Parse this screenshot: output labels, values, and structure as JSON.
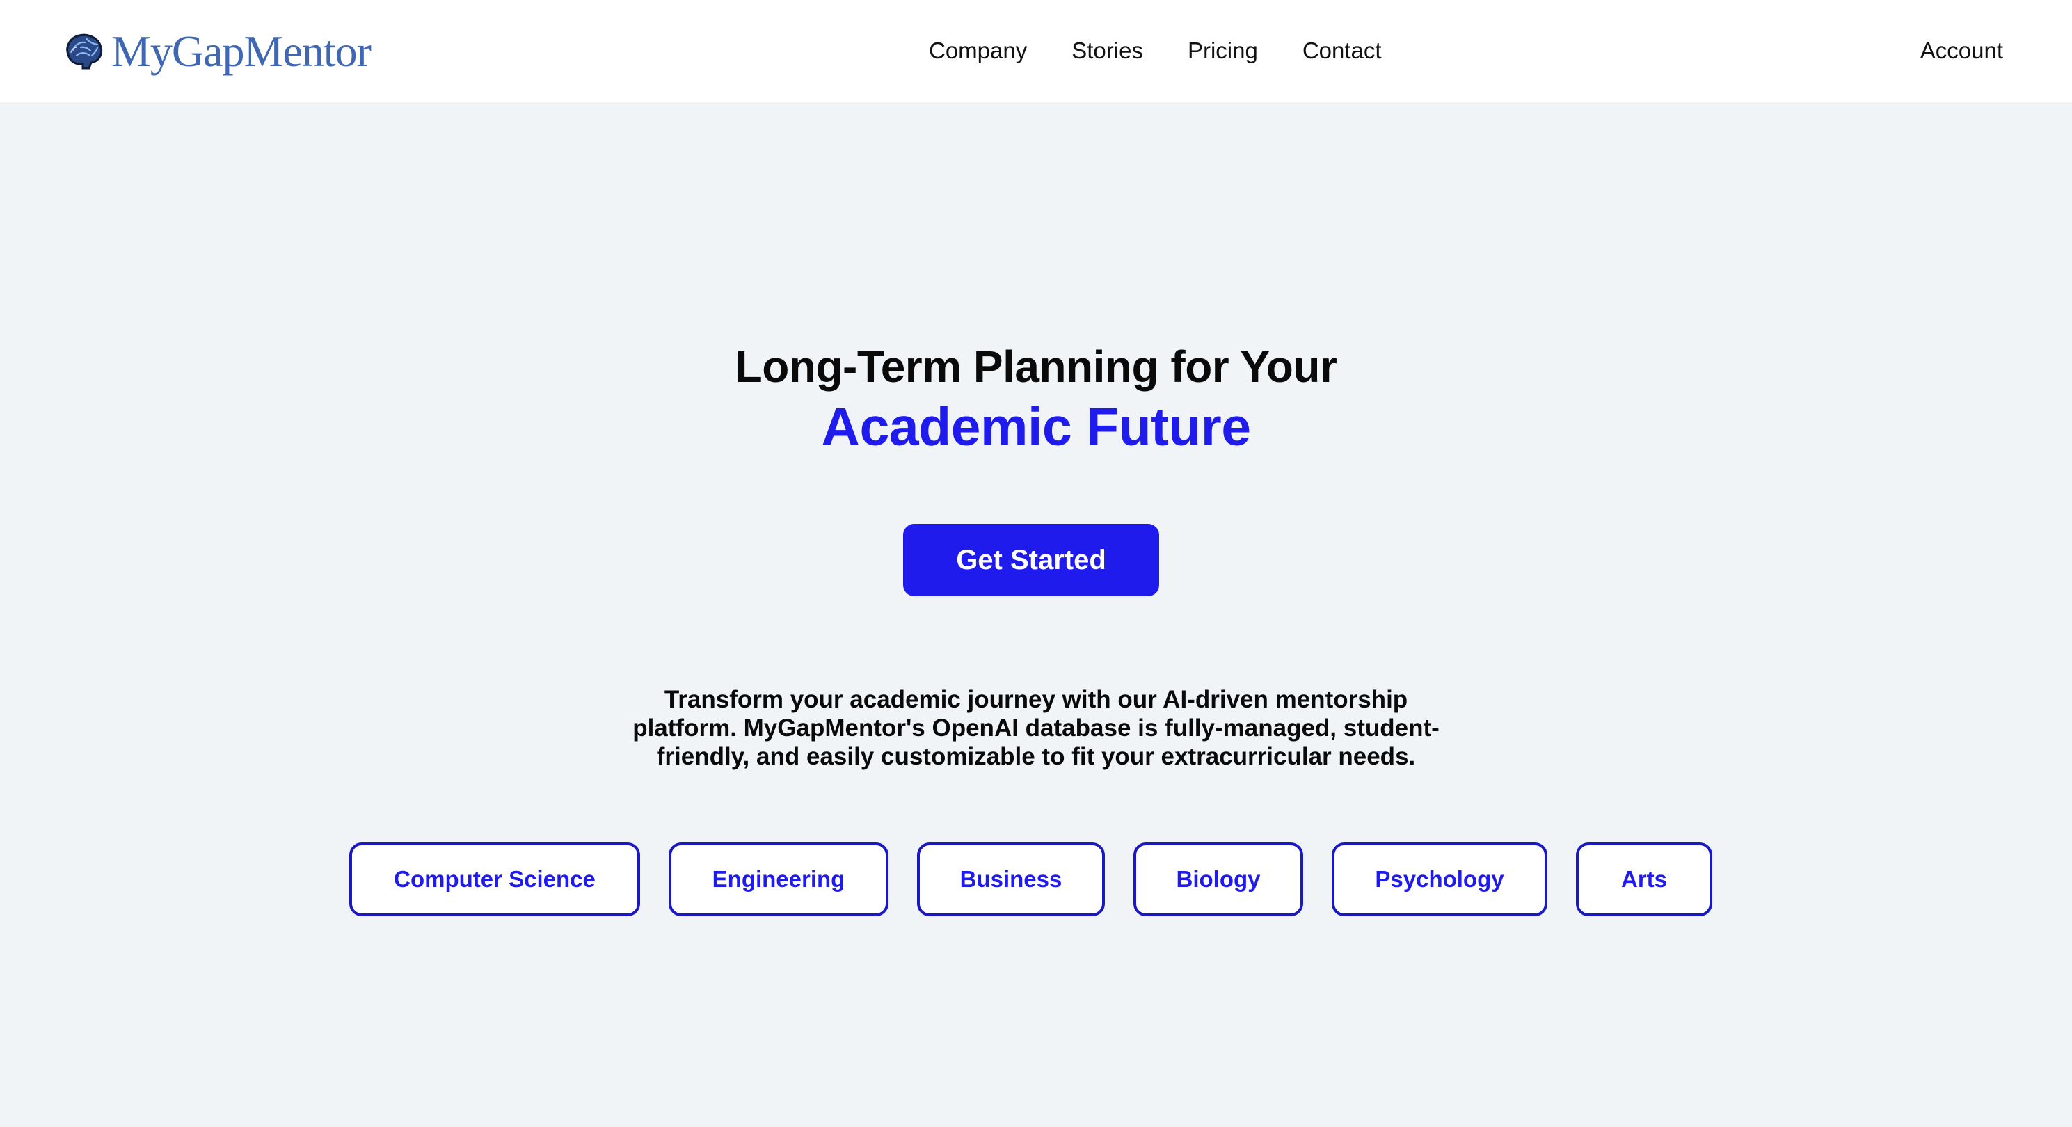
{
  "header": {
    "logo_text": "MyGapMentor",
    "logo_icon": "brain-icon",
    "nav": [
      {
        "label": "Company"
      },
      {
        "label": "Stories"
      },
      {
        "label": "Pricing"
      },
      {
        "label": "Contact"
      }
    ],
    "account_label": "Account"
  },
  "hero": {
    "title_line1": "Long-Term Planning for Your",
    "title_line2": "Academic Future",
    "cta_label": "Get Started",
    "description": "Transform your academic journey with our AI-driven mentorship platform. MyGapMentor's OpenAI database is fully-managed, student-friendly, and easily customizable to fit your extracurricular needs.",
    "categories": [
      {
        "label": "Computer Science"
      },
      {
        "label": "Engineering"
      },
      {
        "label": "Business"
      },
      {
        "label": "Biology"
      },
      {
        "label": "Psychology"
      },
      {
        "label": "Arts"
      }
    ]
  },
  "colors": {
    "accent": "#1f1bed",
    "logo_blue": "#3f67b4",
    "background": "#f0f4f7",
    "header_bg": "#ffffff",
    "text": "#0a0a0a"
  }
}
